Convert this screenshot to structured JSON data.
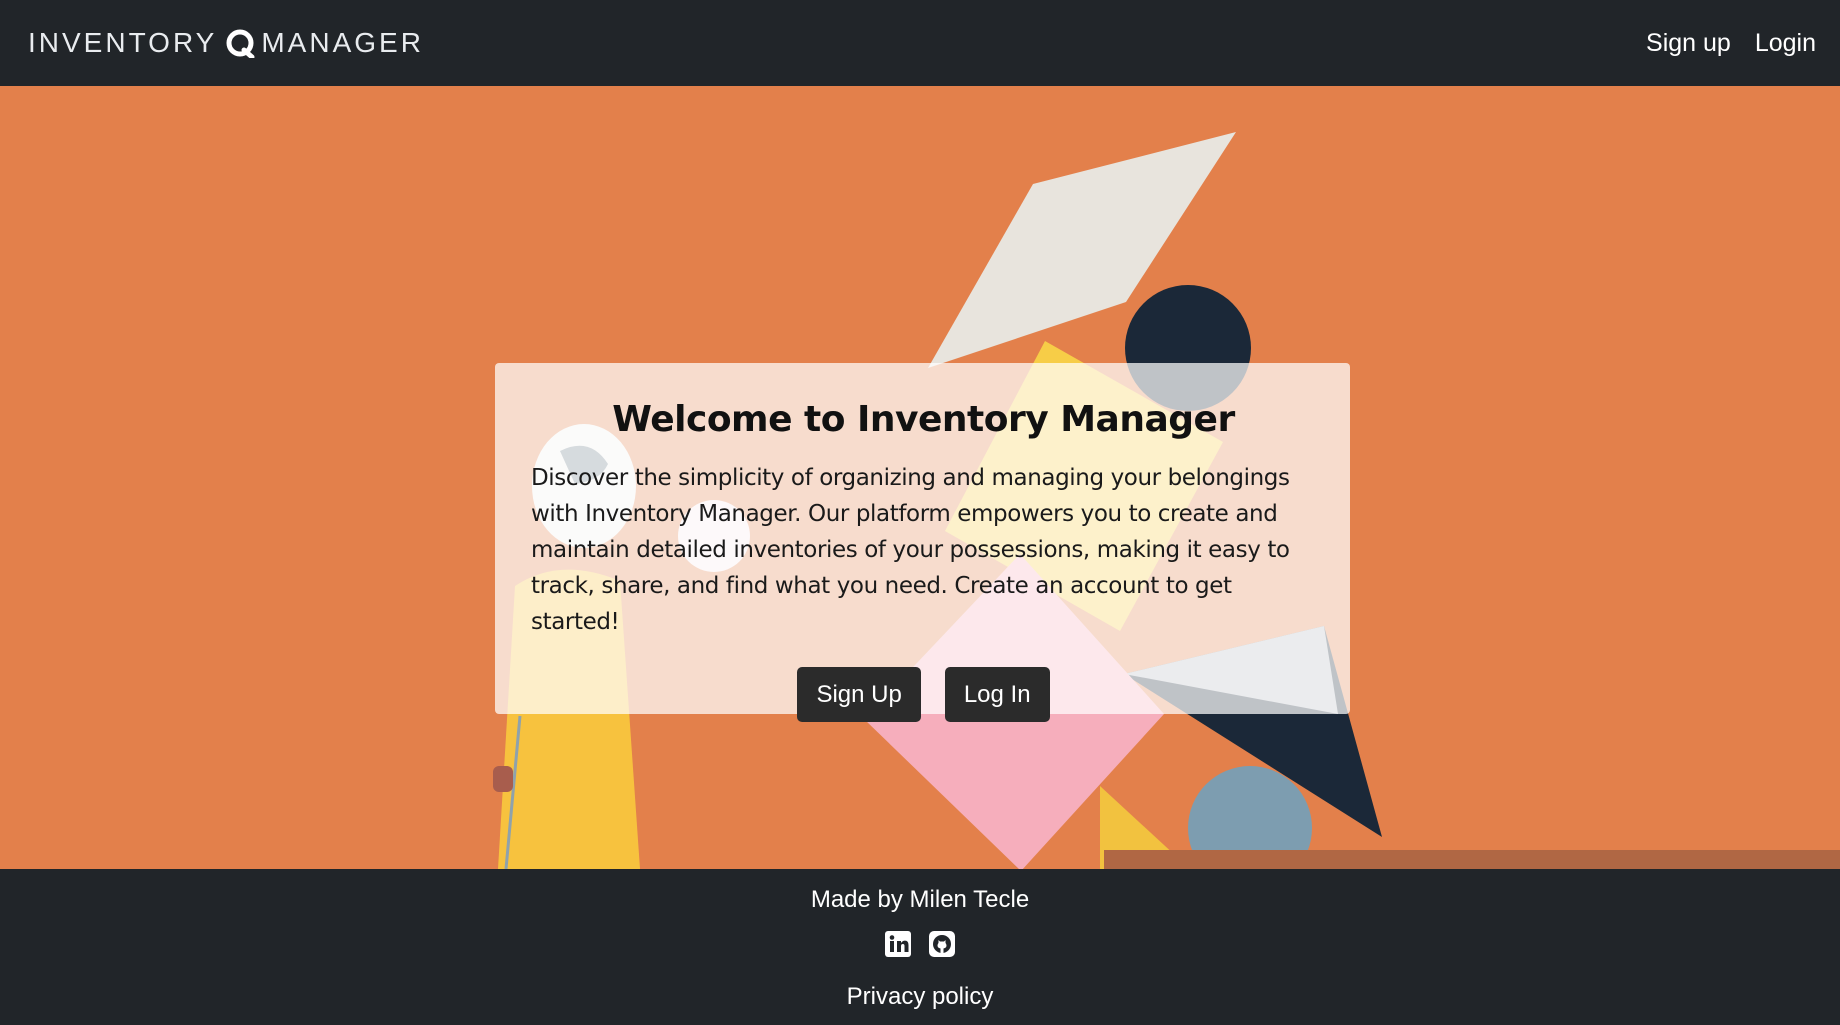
{
  "navbar": {
    "brand_left": "INVENTORY",
    "brand_right": "MANAGER",
    "links": [
      "Sign up",
      "Login"
    ]
  },
  "hero": {
    "title": "Welcome to Inventory Manager",
    "description": "Discover the simplicity of organizing and managing your belongings with Inventory Manager. Our platform empowers you to create and maintain detailed inventories of your possessions, making it easy to track, share, and find what you need. Create an account to get started!",
    "signup_button": "Sign Up",
    "login_button": "Log In"
  },
  "footer": {
    "credit": "Made by Milen Tecle",
    "social_icons": [
      "linkedin-icon",
      "github-icon"
    ],
    "privacy": "Privacy policy"
  },
  "colors": {
    "navbar_bg": "#212529",
    "hero_bg": "#e3804b",
    "button_bg": "#2b2b2b"
  }
}
